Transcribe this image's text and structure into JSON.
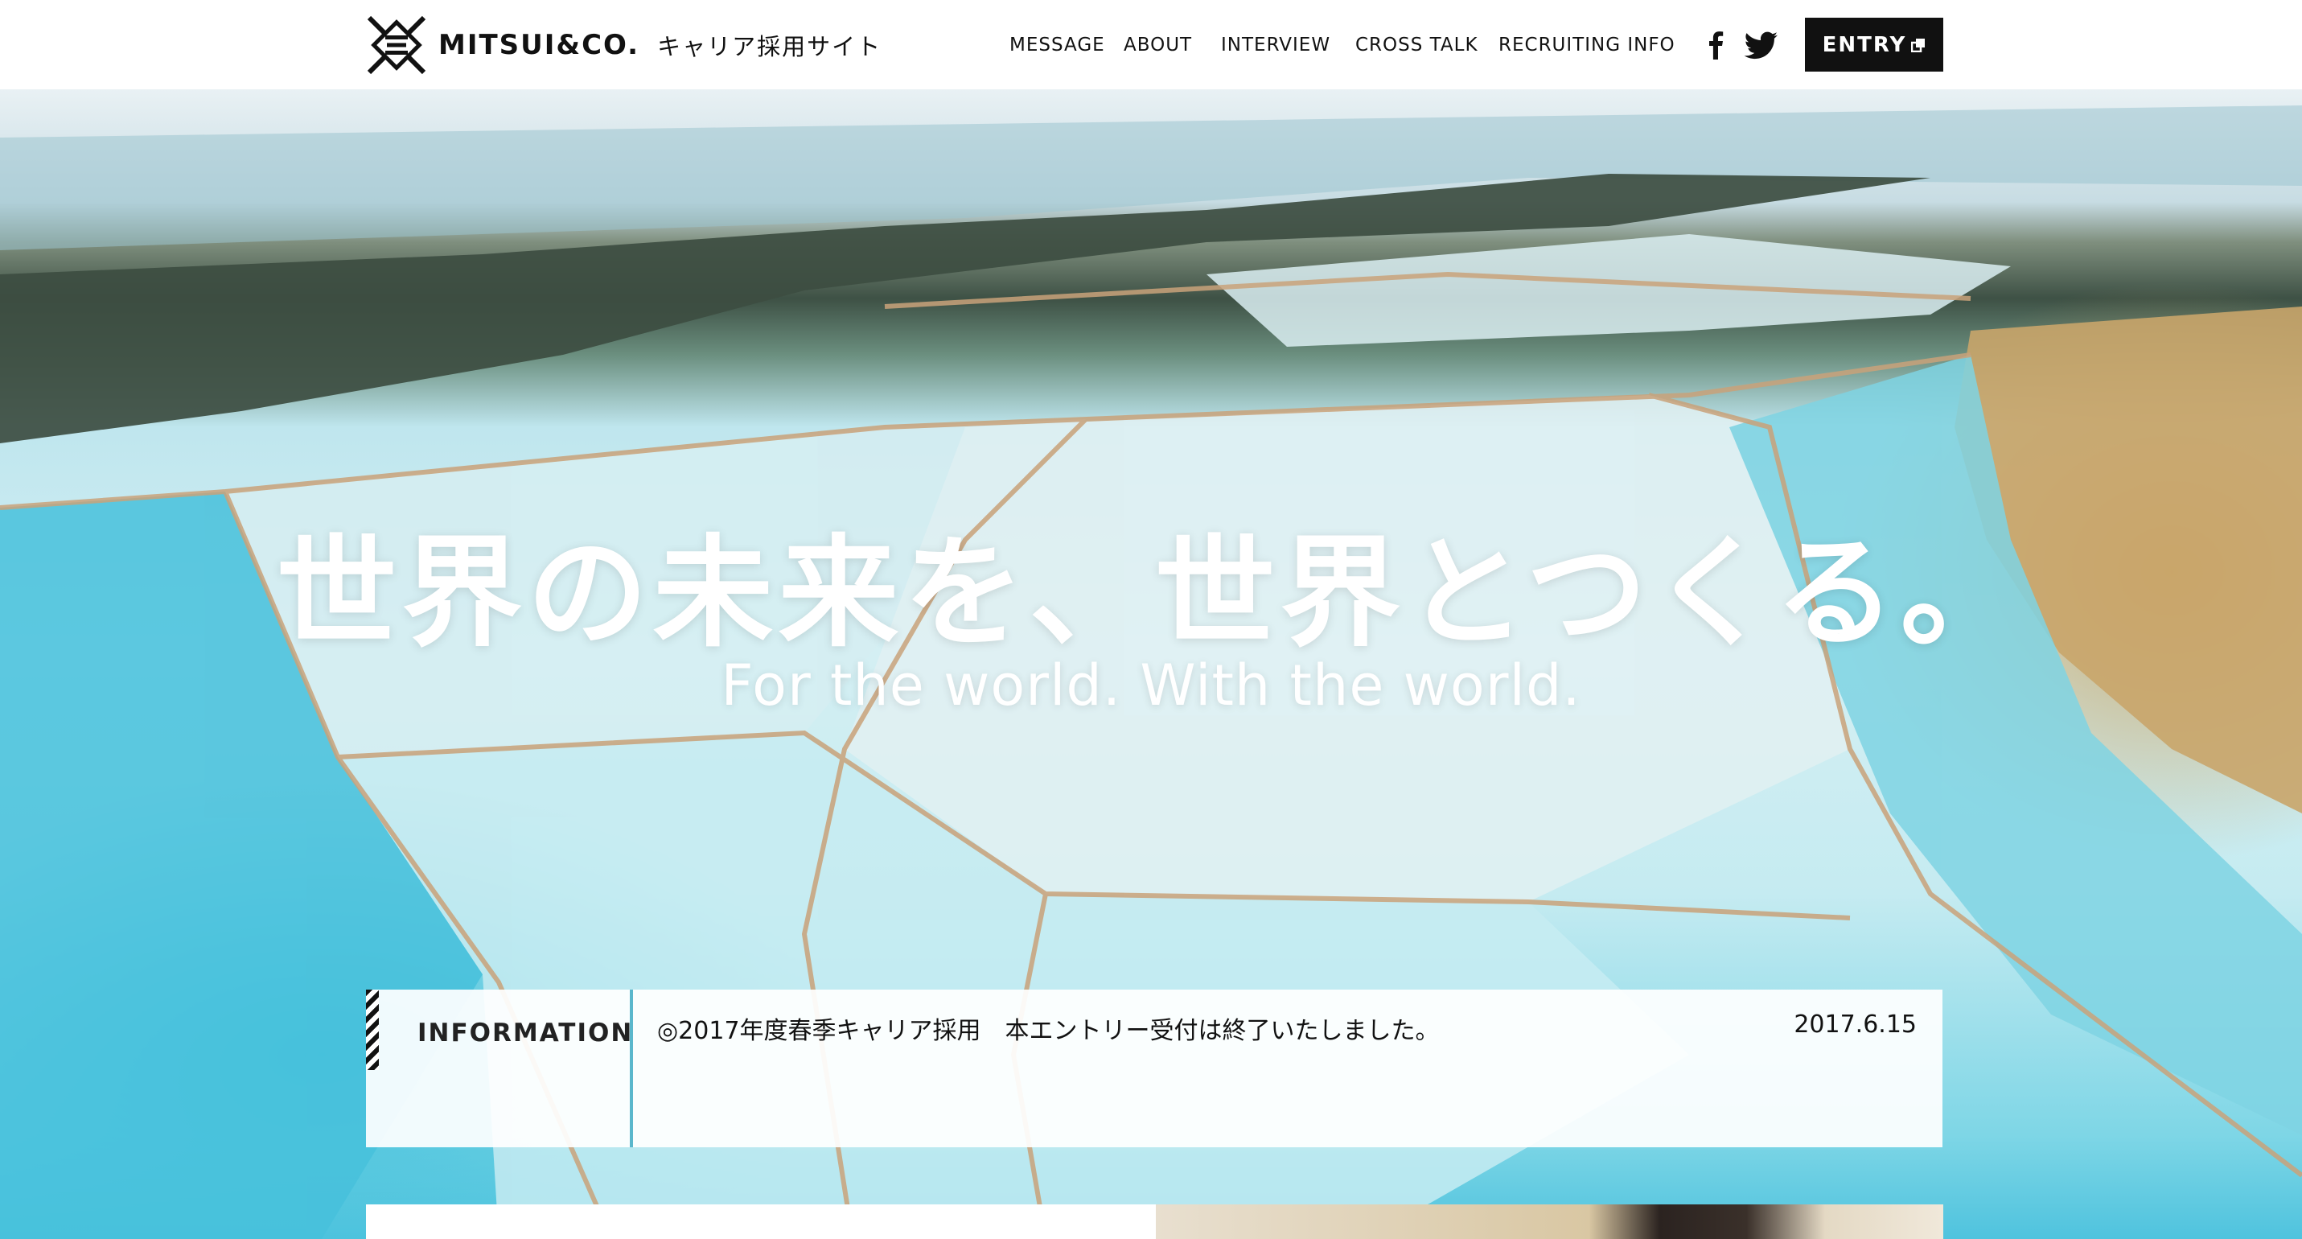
{
  "header": {
    "logo_text": "MITSUI&CO.",
    "logo_sub": "キャリア採用サイト",
    "nav": [
      {
        "label": "MESSAGE"
      },
      {
        "label": "ABOUT"
      },
      {
        "label": "INTERVIEW"
      },
      {
        "label": "CROSS TALK"
      },
      {
        "label": "RECRUITING INFO"
      }
    ],
    "social": [
      "facebook-icon",
      "twitter-icon"
    ],
    "entry_label": "ENTRY"
  },
  "hero": {
    "title": "世界の未来を、世界とつくる。",
    "subtitle": "For the world. With the world."
  },
  "information": {
    "label": "INFORMATION",
    "text": "◎2017年度春季キャリア採用　本エントリー受付は終了いたしました。",
    "date": "2017.6.15"
  },
  "colors": {
    "accent": "#5ab7cc",
    "entry_bg": "#111111"
  }
}
